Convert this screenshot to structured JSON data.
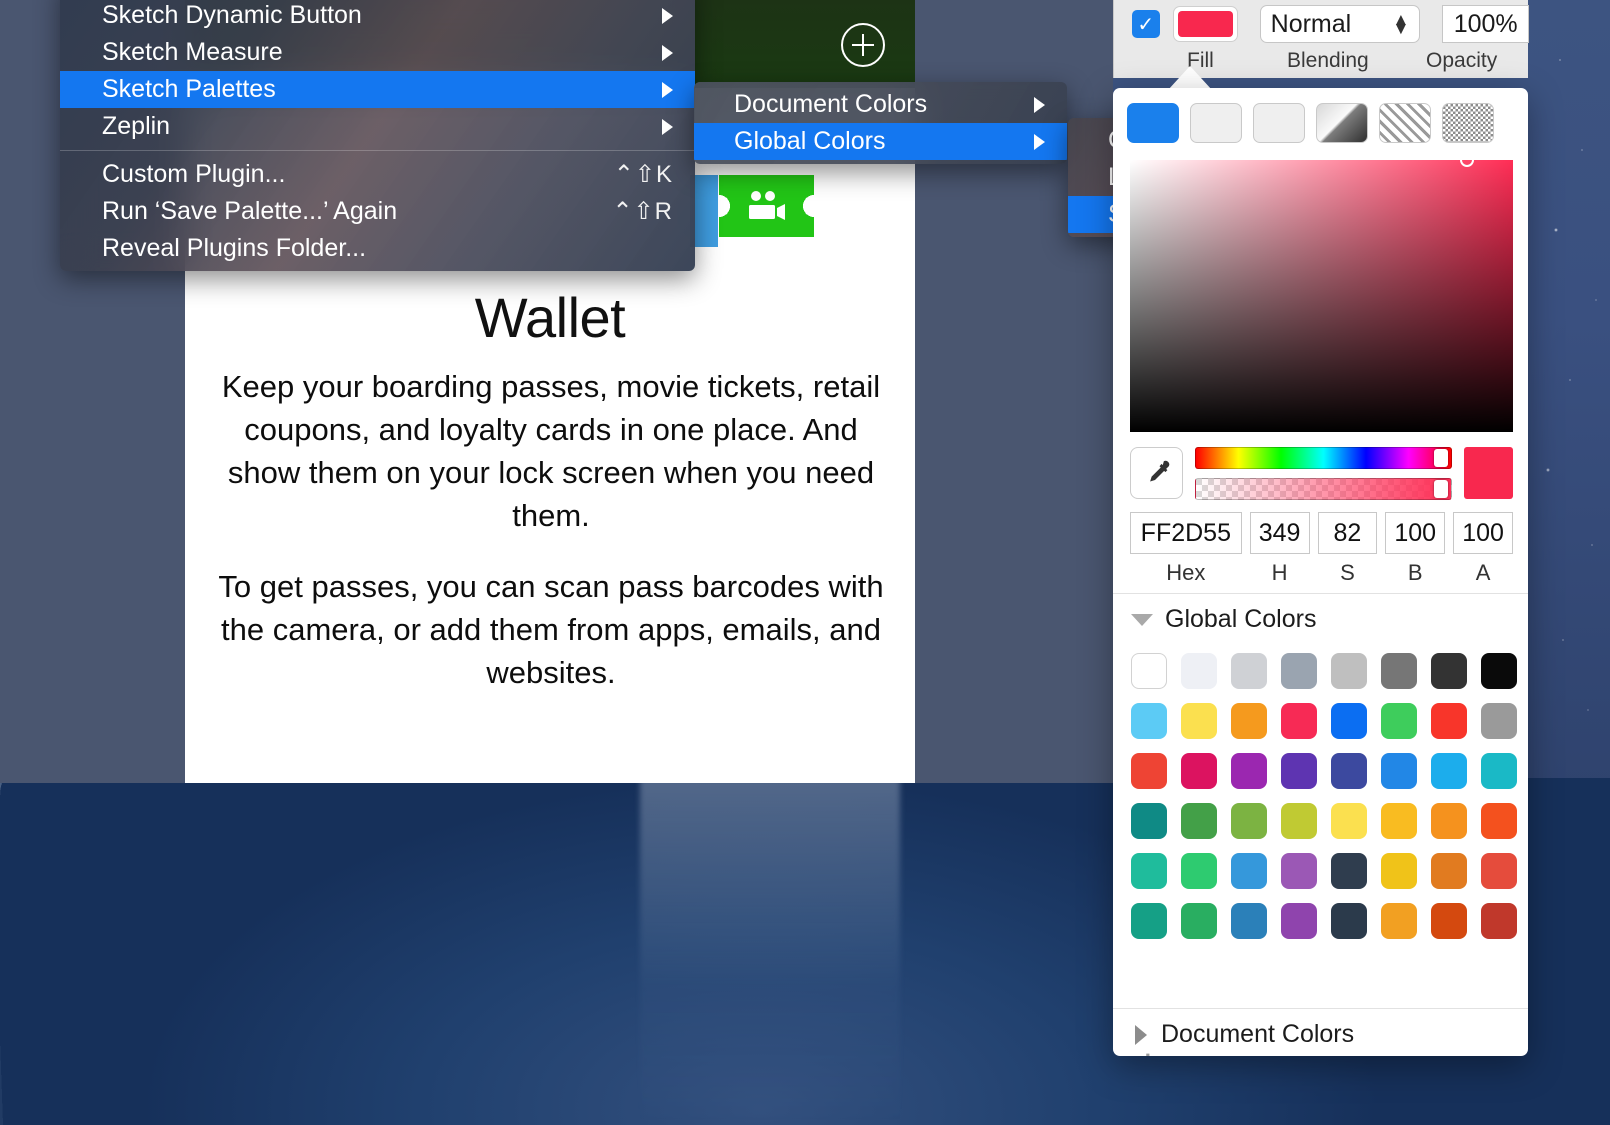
{
  "app": {
    "name": "Sketch",
    "artboard_title": "Wallet"
  },
  "artboard": {
    "title": "Wallet",
    "paragraphs": [
      "Keep your boarding passes, movie tickets, retail coupons, and loyalty cards in one place. And show them on your lock screen when you need them.",
      "To get passes, you can scan pass barcodes with the camera, or add them from apps, emails, and websites."
    ],
    "add_button_icon": "plus-circle-icon",
    "ticket_icon": "movie-ticket-icon"
  },
  "plugins_menu": {
    "items": [
      {
        "label": "Sketch Dynamic Button",
        "submenu": true,
        "highlighted": false,
        "shortcut": ""
      },
      {
        "label": "Sketch Measure",
        "submenu": true,
        "highlighted": false,
        "shortcut": ""
      },
      {
        "label": "Sketch Palettes",
        "submenu": true,
        "highlighted": true,
        "shortcut": ""
      },
      {
        "label": "Zeplin",
        "submenu": true,
        "highlighted": false,
        "shortcut": ""
      },
      {
        "label": "Custom Plugin...",
        "submenu": false,
        "highlighted": false,
        "shortcut": "⌃⇧K"
      },
      {
        "label": "Run ‘Save Palette...’ Again",
        "submenu": false,
        "highlighted": false,
        "shortcut": "⌃⇧R"
      },
      {
        "label": "Reveal Plugins Folder...",
        "submenu": false,
        "highlighted": false,
        "shortcut": ""
      }
    ]
  },
  "palettes_submenu": {
    "items": [
      {
        "label": "Document Colors",
        "submenu": true,
        "highlighted": false
      },
      {
        "label": "Global Colors",
        "submenu": true,
        "highlighted": true
      }
    ]
  },
  "global_colors_submenu": {
    "items": [
      {
        "label": "Clear Palette",
        "highlighted": false
      },
      {
        "label": "Load Palette...",
        "highlighted": false
      },
      {
        "label": "Save Palette...",
        "highlighted": true
      }
    ]
  },
  "inspector": {
    "fill_enabled": true,
    "fill_checkmark": "✓",
    "fill_color": "#F8284E",
    "blending": "Normal",
    "opacity": "100%",
    "labels": {
      "fill": "Fill",
      "blending": "Blending",
      "opacity": "Opacity"
    }
  },
  "color_popover": {
    "fill_types": [
      "solid-fill-icon",
      "linear-gradient-icon",
      "radial-gradient-icon",
      "angular-gradient-icon",
      "gradient-preview-icon",
      "pattern-fill-icon",
      "noise-fill-icon"
    ],
    "eyedropper_icon": "eyedropper-icon",
    "current_color": "#F8284E",
    "values": {
      "hex": "FF2D55",
      "h": "349",
      "s": "82",
      "b": "100",
      "a": "100"
    },
    "value_labels": {
      "hex": "Hex",
      "h": "H",
      "s": "S",
      "b": "B",
      "a": "A"
    },
    "global_colors_label": "Global Colors",
    "document_colors_label": "Document Colors",
    "add_color_label": "+",
    "swatches": [
      "#ffffff",
      "#eef0f5",
      "#cfd1d5",
      "#9aa4b0",
      "#bfbfbf",
      "#767676",
      "#333333",
      "#0a0a0a",
      "#5ccbf5",
      "#fbe04f",
      "#f59a1e",
      "#f72a55",
      "#0b6ef2",
      "#3ecd5c",
      "#f8352a",
      "#9a9a9a",
      "#ee4434",
      "#dc1360",
      "#9b27b0",
      "#5e34b1",
      "#3c499f",
      "#2287e6",
      "#1cadec",
      "#1ab9c6",
      "#0f8a85",
      "#43a048",
      "#7cb342",
      "#c0ca33",
      "#fbe04f",
      "#f9bc21",
      "#f5921e",
      "#f4511e",
      "#1fbc9c",
      "#2ecb70",
      "#3598db",
      "#9b58b5",
      "#2f3d4e",
      "#f0c319",
      "#e17b20",
      "#e54c3c",
      "#15a086",
      "#29ae61",
      "#2b80b9",
      "#8f44ad",
      "#2b3a4b",
      "#f2a022",
      "#d4490f",
      "#c0382b"
    ]
  }
}
